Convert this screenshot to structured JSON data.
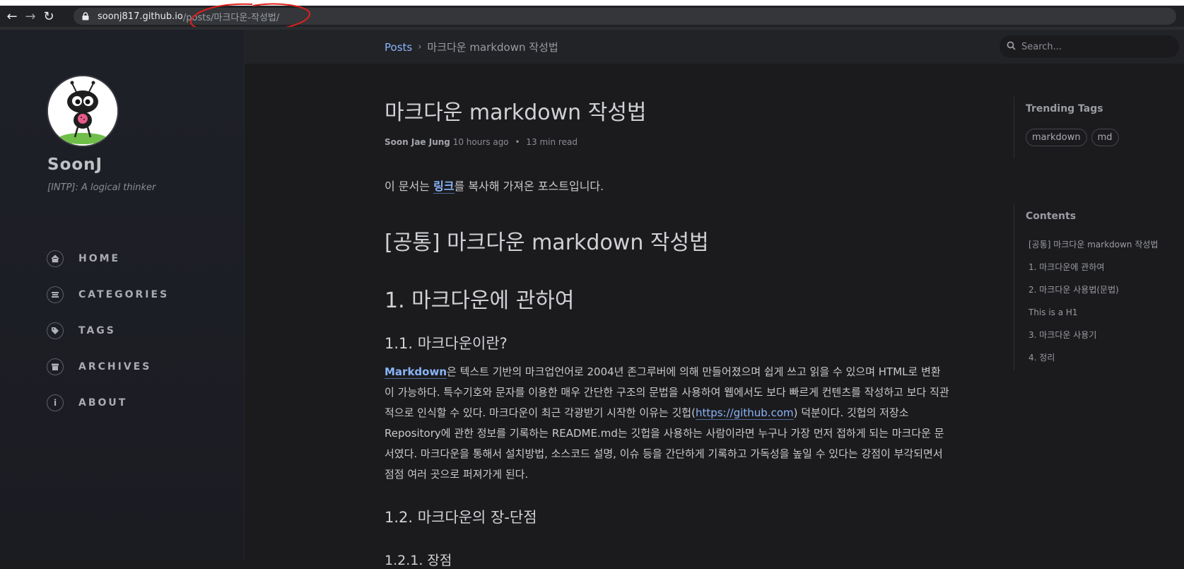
{
  "browser": {
    "url_host": "soonj817.github.io",
    "url_path": "/posts/마크다운-작성법/"
  },
  "sidebar": {
    "site_title": "SoonJ",
    "site_subtitle": "[INTP]: A logical thinker",
    "nav": [
      {
        "label": "HOME",
        "icon": "home-icon"
      },
      {
        "label": "CATEGORIES",
        "icon": "stream-icon"
      },
      {
        "label": "TAGS",
        "icon": "tags-icon"
      },
      {
        "label": "ARCHIVES",
        "icon": "archive-icon"
      },
      {
        "label": "ABOUT",
        "icon": "info-icon"
      }
    ]
  },
  "header": {
    "breadcrumb_link": "Posts",
    "breadcrumb_sep": "›",
    "breadcrumb_current": "마크다운 markdown 작성법",
    "search_placeholder": "Search..."
  },
  "post": {
    "title": "마크다운 markdown 작성법",
    "author": "Soon Jae Jung",
    "time_ago": "10 hours ago",
    "meta_sep": "•",
    "read_time": "13 min read",
    "intro_before": "이 문서는 ",
    "intro_link": "링크",
    "intro_after": "를 복사해 가져온 포스트입니다.",
    "h1": "[공통] 마크다운 markdown 작성법",
    "h2": "1. 마크다운에 관하여",
    "h3_1": "1.1. 마크다운이란?",
    "para_link": "Markdown",
    "para_part1": "은 텍스트 기반의 마크업언어로 2004년 존그루버에 의해 만들어졌으며 쉽게 쓰고 읽을 수 있으며 HTML로 변환이 가능하다. 특수기호와 문자를 이용한 매우 간단한 구조의 문법을 사용하여 웹에서도 보다 빠르게 컨텐츠를 작성하고 보다 직관적으로 인식할 수 있다. 마크다운이 최근 각광받기 시작한 이유는 깃헙(",
    "para_url": "https://github.com",
    "para_part2": ") 덕분이다. 깃헙의 저장소Repository에 관한 정보를 기록하는 README.md는 깃헙을 사용하는 사람이라면 누구나 가장 먼저 접하게 되는 마크다운 문서였다. 마크다운을 통해서 설치방법, 소스코드 설명, 이슈 등을 간단하게 기록하고 가독성을 높일 수 있다는 강점이 부각되면서 점점 여러 곳으로 퍼져가게 된다.",
    "h3_2": "1.2. 마크다운의 장-단점",
    "h4_1": "1.2.1. 장점"
  },
  "trending": {
    "title": "Trending Tags",
    "tags": [
      "markdown",
      "md"
    ]
  },
  "toc": {
    "title": "Contents",
    "items": [
      "[공통] 마크다운 markdown 작성법",
      "1. 마크다운에 관하여",
      "2. 마크다운 사용법(문법)",
      "This is a H1",
      "3. 마크다운 사용기",
      "4. 정리"
    ]
  },
  "colors": {
    "accent": "#8ab4f8",
    "annotation": "#e0201c",
    "background": "#1b1b1e"
  }
}
